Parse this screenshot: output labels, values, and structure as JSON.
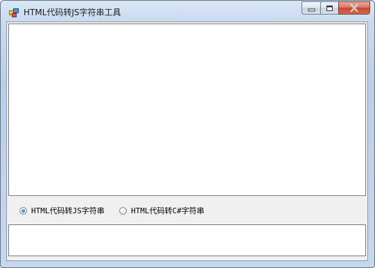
{
  "window": {
    "title": "HTML代码转JS字符串工具",
    "icon": "app-icon"
  },
  "caption_buttons": {
    "minimize_icon": "minimize-icon",
    "maximize_icon": "maximize-icon",
    "close_icon": "close-icon",
    "close_color": "#c4462f"
  },
  "input": {
    "value": "",
    "placeholder": ""
  },
  "options": {
    "js_label": "HTML代码转JS字符串",
    "csharp_label": "HTML代码转C#字符串",
    "selected": "js"
  },
  "output": {
    "value": "",
    "placeholder": ""
  }
}
